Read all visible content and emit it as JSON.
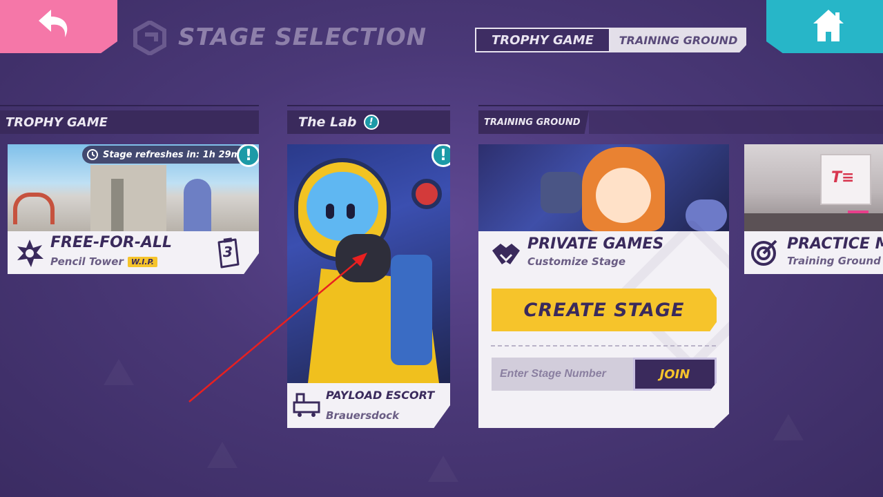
{
  "header": {
    "title": "STAGE SELECTION",
    "tabs": [
      "TROPHY GAME",
      "TRAINING GROUND"
    ],
    "active_tab": "TROPHY GAME"
  },
  "sections": {
    "trophy": {
      "header": "TROPHY GAME",
      "card": {
        "refresh_label": "Stage refreshes in: 1h 29m",
        "mode": "FREE-FOR-ALL",
        "map": "Pencil Tower",
        "badge": "W.I.P.",
        "count": "3"
      }
    },
    "lab": {
      "header": "The Lab",
      "card": {
        "mode": "PAYLOAD ESCORT",
        "map": "Brauersdock"
      }
    },
    "training": {
      "header": "TRAINING GROUND",
      "private": {
        "title": "PRIVATE GAMES",
        "subtitle": "Customize Stage",
        "create_label": "CREATE STAGE",
        "input_placeholder": "Enter Stage Number",
        "join_label": "JOIN"
      },
      "practice": {
        "title": "PRACTICE M",
        "subtitle": "Training Ground",
        "logo_text": "T≡"
      }
    }
  },
  "colors": {
    "back": "#f577a8",
    "home": "#27b6c8",
    "accent_yellow": "#f6c42b",
    "dark_purple": "#3a2a5c",
    "info_teal": "#1c9aa7"
  }
}
